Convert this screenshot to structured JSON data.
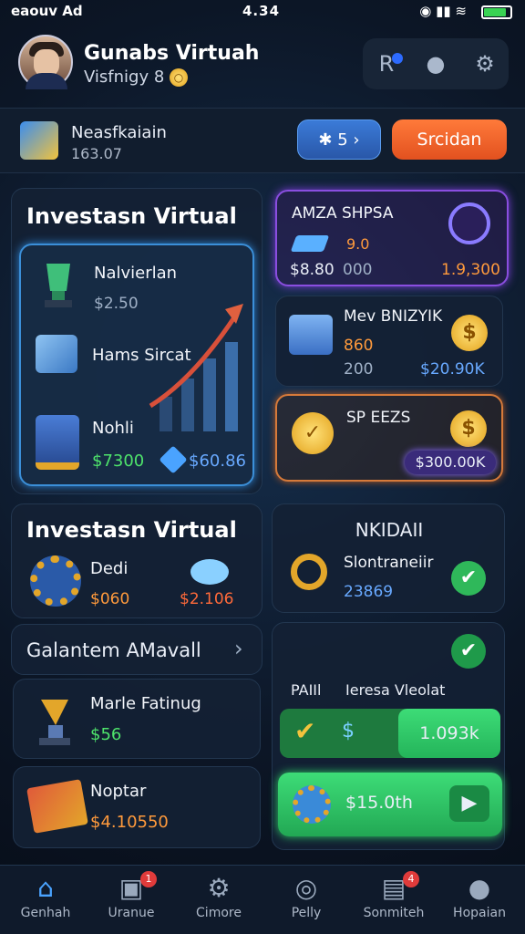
{
  "status": {
    "left": "eaouv Ad",
    "time": "4.34"
  },
  "header": {
    "name": "Gunabs Virtuah",
    "sub": "Visfnigy 8",
    "coin": "○"
  },
  "subbar": {
    "title": "Neasfkaiain",
    "value": "163.07",
    "blue_btn": "✱ 5  ›",
    "orange_btn": "Srcidan"
  },
  "left_panel": {
    "title": "Investasn Virtual",
    "items": [
      {
        "label": "Nalvierlan",
        "value": "$2.50"
      },
      {
        "label": "Hams Sircat"
      },
      {
        "label": "Nohli",
        "value_a": "$7300",
        "value_b": "$60.86"
      }
    ]
  },
  "right_cards": [
    {
      "title": "AMZA SHPSA",
      "v1": "9.0",
      "v2": "$8.80",
      "v3": "000",
      "v4": "1.9,300"
    },
    {
      "title": "Mev BNIZYIK",
      "v1": "860",
      "v2": "200",
      "v3": "$20.90K"
    },
    {
      "title": "SP EEZS",
      "v1": "$300.00K"
    }
  ],
  "invest2": {
    "title": "Investasn Virtual",
    "label": "Dedi",
    "v1": "$060",
    "v2": "$2.106"
  },
  "galantem": {
    "label": "Galantem AMavall"
  },
  "list": [
    {
      "label": "Marle Fatinug",
      "value": "$56"
    },
    {
      "label": "Noptar",
      "value": "$4.10550"
    }
  ],
  "right2": {
    "title": "NKIDAII",
    "label": "Slontraneiir",
    "value": "23869",
    "pair_label": "PAIIl",
    "pair_sub": "Ieresa Vleolat",
    "pair_value": "1.093k",
    "cta": "$15.0th"
  },
  "nav": [
    {
      "label": "Genhah",
      "icon": "home-icon"
    },
    {
      "label": "Uranue",
      "icon": "inbox-icon",
      "badge": "1"
    },
    {
      "label": "Cimore",
      "icon": "gear-icon"
    },
    {
      "label": "Pelly",
      "icon": "compass-icon"
    },
    {
      "label": "Sonmiteh",
      "icon": "chat-icon",
      "badge": "4"
    },
    {
      "label": "Hopaian",
      "icon": "user-icon"
    }
  ],
  "colors": {
    "accent_blue": "#3b7bd8",
    "accent_orange": "#e2511f",
    "accent_green": "#2ecc71",
    "accent_purple": "#8a4ee0"
  }
}
